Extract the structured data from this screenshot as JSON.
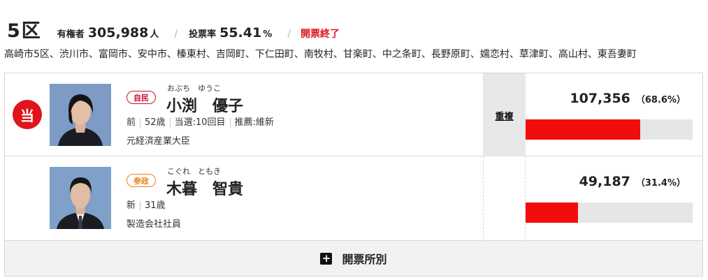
{
  "header": {
    "district": "5区",
    "electorate_label": "有権者",
    "electorate_value": "305,988",
    "electorate_unit": "人",
    "separator": "/",
    "turnout_label": "投票率",
    "turnout_value": "55.41",
    "turnout_unit": "%",
    "count_status": "開票終了"
  },
  "areas": "高崎市5区、渋川市、富岡市、安中市、榛東村、吉岡町、下仁田町、南牧村、甘楽町、中之条町、長野原町、嬬恋村、草津町、高山村、東吾妻町",
  "candidates": [
    {
      "elected_badge": "当",
      "party": "自民",
      "party_color": "#c8102e",
      "furigana": "おぶち　ゆうこ",
      "name": "小渕　優子",
      "status": "前",
      "age": "52歳",
      "wins": "当選:10回目",
      "endorsement": "推薦:維新",
      "career": "元経済産業大臣",
      "duplicate": "重複",
      "votes": "107,356",
      "percent": "（68.6%）",
      "share": 0.686,
      "photo_icon": "candidate-photo-female"
    },
    {
      "party": "参政",
      "party_color": "#e8821e",
      "furigana": "こぐれ　ともき",
      "name": "木暮　智貴",
      "status": "新",
      "age": "31歳",
      "career": "製造会社社員",
      "votes": "49,187",
      "percent": "（31.4%）",
      "share": 0.314,
      "photo_icon": "candidate-photo-male"
    }
  ],
  "footer": {
    "icon": "plus-icon",
    "label": "開票所別"
  },
  "colors": {
    "accent_red": "#e0141b",
    "bar_red": "#f20d0d",
    "bar_track": "#e6e6e6"
  }
}
